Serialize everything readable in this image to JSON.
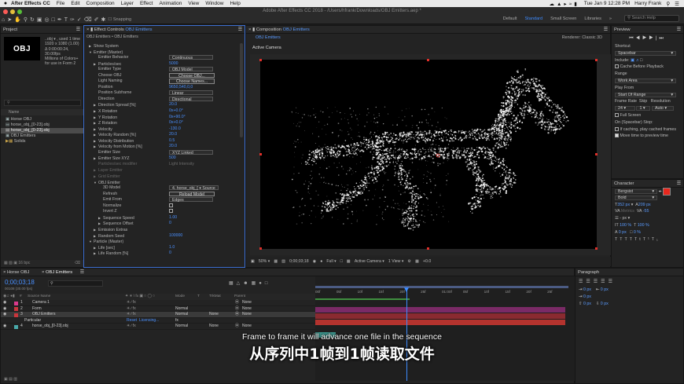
{
  "menubar": {
    "apple": "",
    "app": "After Effects CC",
    "items": [
      "File",
      "Edit",
      "Composition",
      "Layer",
      "Effect",
      "Animation",
      "View",
      "Window",
      "Help"
    ],
    "clock": "Tue Jan 9  12:28 PM",
    "user": "Harry Frank"
  },
  "window": {
    "title": "Adobe After Effects CC 2018 - /Users/hfrank/Downloads/OBJ Emitters.aep *",
    "snapping": "Snapping",
    "workspaces": [
      "Default",
      "Standard",
      "Small Screen",
      "Libraries"
    ],
    "active_workspace": "Standard",
    "search_placeholder": "Search Help"
  },
  "project": {
    "tab": "Project",
    "thumb_text": "OBJ",
    "info": [
      "..obj ▾ , used 1 time",
      "1920 x 1080 (1.00)",
      "Δ 0:00:00:24, 30.00fps",
      "Millions of Colors+",
      "for use in Form 2"
    ],
    "search_placeholder": "",
    "col_name": "Name",
    "items": [
      {
        "name": "Horse OBJ",
        "selected": false
      },
      {
        "name": "horse_obj_[0-23].obj",
        "selected": false
      },
      {
        "name": "horse_obj_[0-23].obj",
        "selected": true
      },
      {
        "name": "OBJ Emitters",
        "selected": false
      },
      {
        "name": "Solids",
        "selected": false
      }
    ],
    "bpc": "16 bpc"
  },
  "effect_controls": {
    "tab_prefix": "Effect Controls",
    "tab_layer": "OBJ Emitters",
    "breadcrumb": "OBJ Emitters • OBJ Emitters",
    "rows": [
      {
        "indent": 1,
        "tw": "▶",
        "label": "Show System",
        "val": "",
        "kind": "none"
      },
      {
        "indent": 1,
        "tw": "▼",
        "label": "Emitter (Master)",
        "val": "",
        "kind": "none"
      },
      {
        "indent": 2,
        "tw": "",
        "label": "Emitter Behavior",
        "val": "Continuous",
        "kind": "dd"
      },
      {
        "indent": 2,
        "tw": "▶",
        "label": "Particles/sec",
        "val": "5000",
        "kind": "blue"
      },
      {
        "indent": 2,
        "tw": "",
        "label": "Emitter Type",
        "val": "OBJ Model",
        "kind": "dd"
      },
      {
        "indent": 2,
        "tw": "",
        "label": "Choose OBJ",
        "val": "Choose OBJ...",
        "kind": "btn"
      },
      {
        "indent": 2,
        "tw": "",
        "label": "Light Naming",
        "val": "Choose Names...",
        "kind": "btn"
      },
      {
        "indent": 2,
        "tw": "",
        "label": "Position",
        "val": "9650,540,0,0",
        "kind": "blue"
      },
      {
        "indent": 2,
        "tw": "",
        "label": "Position Subframe",
        "val": "Linear",
        "kind": "dd"
      },
      {
        "indent": 2,
        "tw": "",
        "label": "Direction",
        "val": "Directional",
        "kind": "dd"
      },
      {
        "indent": 2,
        "tw": "▶",
        "label": "Direction Spread [%]",
        "val": "20.0",
        "kind": "blue"
      },
      {
        "indent": 2,
        "tw": "▶",
        "label": "X Rotation",
        "val": "0x+0.0°",
        "kind": "blue"
      },
      {
        "indent": 2,
        "tw": "▶",
        "label": "Y Rotation",
        "val": "0x+90.0°",
        "kind": "blue"
      },
      {
        "indent": 2,
        "tw": "▶",
        "label": "Z Rotation",
        "val": "0x+0.0°",
        "kind": "blue"
      },
      {
        "indent": 2,
        "tw": "▶",
        "label": "Velocity",
        "val": "-130.0",
        "kind": "blue"
      },
      {
        "indent": 2,
        "tw": "▶",
        "label": "Velocity Random [%]",
        "val": "20.0",
        "kind": "blue"
      },
      {
        "indent": 2,
        "tw": "▶",
        "label": "Velocity Distribution",
        "val": "0.5",
        "kind": "blue"
      },
      {
        "indent": 2,
        "tw": "▶",
        "label": "Velocity from Motion [%]",
        "val": "20.0",
        "kind": "blue"
      },
      {
        "indent": 2,
        "tw": "",
        "label": "Emitter Size",
        "val": "XYZ Linked",
        "kind": "dd"
      },
      {
        "indent": 2,
        "tw": "▶",
        "label": "Emitter Size XYZ",
        "val": "500",
        "kind": "blue"
      },
      {
        "indent": 2,
        "tw": "",
        "label": "Particles/sec modifier",
        "val": "Light Intensity",
        "kind": "dimval",
        "dim": true
      },
      {
        "indent": 2,
        "tw": "▶",
        "label": "Layer Emitter",
        "val": "",
        "kind": "none",
        "dim": true
      },
      {
        "indent": 2,
        "tw": "▶",
        "label": "Grid Emitter",
        "val": "",
        "kind": "none",
        "dim": true
      },
      {
        "indent": 2,
        "tw": "▼",
        "label": "OBJ Emitter",
        "val": "",
        "kind": "none"
      },
      {
        "indent": 3,
        "tw": "",
        "label": "3D Model",
        "val": "4. horse_obj_[ ▾     Source",
        "kind": "dd"
      },
      {
        "indent": 3,
        "tw": "",
        "label": "Refresh",
        "val": "Reload Model",
        "kind": "btn"
      },
      {
        "indent": 3,
        "tw": "",
        "label": "Emit From",
        "val": "Edges",
        "kind": "dd"
      },
      {
        "indent": 3,
        "tw": "",
        "label": "Normalize",
        "val": "",
        "kind": "check"
      },
      {
        "indent": 3,
        "tw": "",
        "label": "Invert Z",
        "val": "",
        "kind": "check"
      },
      {
        "indent": 3,
        "tw": "▶",
        "label": "Sequence Speed",
        "val": "1.00",
        "kind": "blue"
      },
      {
        "indent": 3,
        "tw": "▶",
        "label": "Sequence Offset",
        "val": "0",
        "kind": "blue"
      },
      {
        "indent": 2,
        "tw": "▶",
        "label": "Emission Extras",
        "val": "",
        "kind": "none"
      },
      {
        "indent": 2,
        "tw": "▶",
        "label": "Random Seed",
        "val": "100000",
        "kind": "blue"
      },
      {
        "indent": 1,
        "tw": "▼",
        "label": "Particle (Master)",
        "val": "",
        "kind": "none"
      },
      {
        "indent": 2,
        "tw": "▶",
        "label": "Life [sec]",
        "val": "1.0",
        "kind": "blue"
      },
      {
        "indent": 2,
        "tw": "▶",
        "label": "Life Random [%]",
        "val": "0",
        "kind": "blue"
      }
    ]
  },
  "composition": {
    "tab_prefix": "Composition",
    "tab_name": "OBJ Emitters",
    "subtab": "OBJ Emitters",
    "renderer_label": "Renderer:",
    "renderer": "Classic 3D",
    "camera_label": "Active Camera",
    "zoom": "50%",
    "timecode": "0;00;03;18",
    "resolution": "Full",
    "view_camera": "Active Camera",
    "views": "1 View",
    "exposure": "+0.0"
  },
  "preview": {
    "tab": "Preview",
    "shortcut_label": "Shortcut",
    "shortcut": "Spacebar",
    "include_label": "Include:",
    "cache": "Cache Before Playback",
    "range_label": "Range",
    "range": "Work Area",
    "play_from_label": "Play From",
    "play_from": "Start Of Range",
    "frame_rate_label": "Frame Rate",
    "skip_label": "Skip",
    "resolution_label": "Resolution",
    "frame_rate": "24",
    "skip": "1",
    "resolution": "Auto",
    "fullscreen": "Full Screen",
    "on_stop": "On (Spacebar) Stop:",
    "if_caching": "If caching, play cached frames",
    "move_time": "Move time to preview time"
  },
  "character": {
    "tab": "Character",
    "font": "Bergsist",
    "style": "Bold",
    "size": "352 px",
    "leading": "209 px",
    "kerning": "Metrics",
    "tracking": "-55",
    "unit": "- px",
    "vscale": "100 %",
    "hscale": "100 %",
    "baseline": "0 px",
    "tsume": "0 %",
    "fill_color": "#e8281e"
  },
  "paragraph": {
    "tab": "Paragraph",
    "indent_left": "0 px",
    "indent_right": "0 px",
    "indent_first": "0 px",
    "space_before": "0 px",
    "space_after": "0 px"
  },
  "timeline": {
    "tabs": [
      "Horse OBJ",
      "OBJ Emitters"
    ],
    "active_tab": "OBJ Emitters",
    "timecode": "0;00;03;18",
    "fps_info": "00108 (30.00 fps)",
    "search_placeholder": "",
    "cols": {
      "num": "#",
      "name": "Source Name",
      "mode": "Mode",
      "trkmat": "TrkMat",
      "parent": "Parent"
    },
    "layers": [
      {
        "num": "1",
        "name": "Camera 1",
        "mode": "",
        "trkmat": "",
        "parent": "None",
        "color": "#d93a8c",
        "selected": false
      },
      {
        "num": "2",
        "name": "Form",
        "mode": "Normal",
        "trkmat": "",
        "parent": "None",
        "color": "#c9363c",
        "selected": false
      },
      {
        "num": "3",
        "name": "OBJ Emitters",
        "mode": "Normal",
        "trkmat": "None",
        "parent": "None",
        "color": "#c9363c",
        "selected": true
      },
      {
        "num": "",
        "name": "Particular",
        "mode": "",
        "trkmat": "",
        "parent": "",
        "color": "",
        "selected": false,
        "effect": true,
        "reset": "Reset",
        "licensing": "Licensing..."
      },
      {
        "num": "4",
        "name": "horse_obj_[0-23].obj",
        "mode": "Normal",
        "trkmat": "None",
        "parent": "None",
        "color": "#49a9a9",
        "selected": false
      }
    ],
    "ruler": [
      "00f",
      "05f",
      "10f",
      "15f",
      "20f",
      "25f",
      "01:00f",
      "05f",
      "10f",
      "15f",
      "20f",
      "25f"
    ],
    "bar_colors": {
      "camera": "#7a2a66",
      "form": "#8a2a30",
      "obj": "#b4332e",
      "horse": "#3a8e86"
    },
    "cti_color": "#3d8bff",
    "workarea_color": "#4b5b83"
  },
  "subtitles": {
    "en": "Frame to frame it will advance one file in the sequence",
    "zh": "从序列中1帧到1帧读取文件"
  }
}
